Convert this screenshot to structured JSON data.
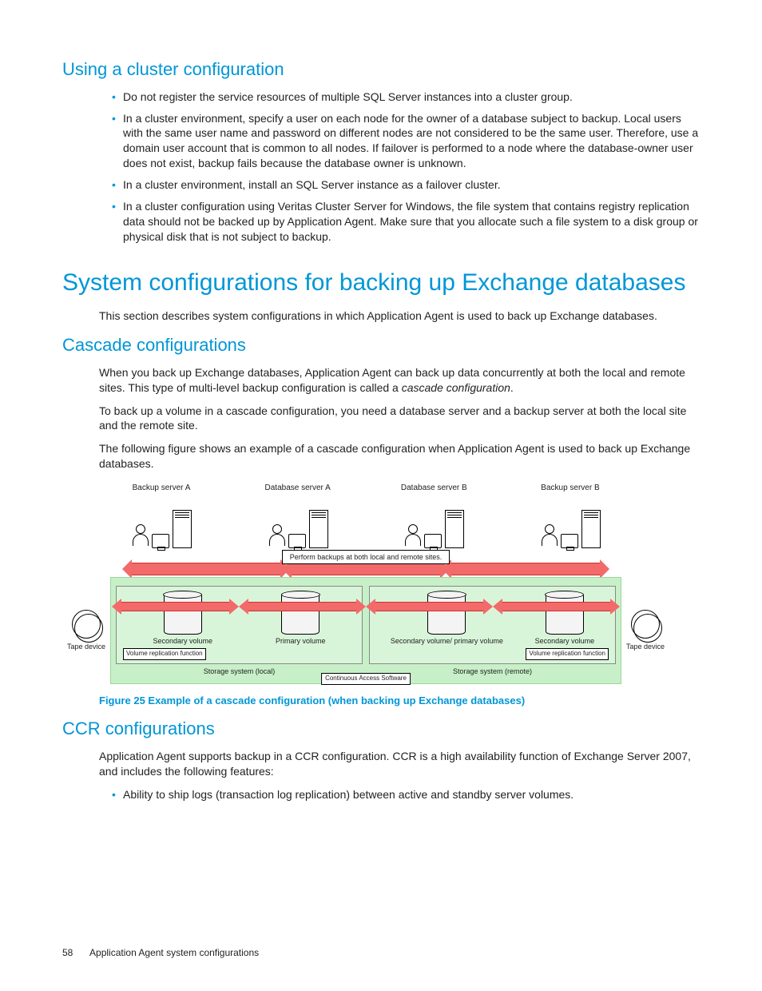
{
  "headings": {
    "using_cluster": "Using a cluster configuration",
    "sys_config": "System configurations for backing up Exchange databases",
    "cascade": "Cascade configurations",
    "ccr": "CCR configurations"
  },
  "bullets_cluster": [
    "Do not register the service resources of multiple SQL Server instances into a cluster group.",
    "In a cluster environment, specify a user on each node for the owner of a database subject to backup. Local users with the same user name and password on different nodes are not considered to be the same user. Therefore, use a domain user account that is common to all nodes. If failover is performed to a node where the database-owner user does not exist, backup fails because the database owner is unknown.",
    "In a cluster environment, install an SQL Server instance as a failover cluster.",
    "In a cluster configuration using Veritas Cluster Server for Windows, the file system that contains registry replication data should not be backed up by Application Agent. Make sure that you allocate such a file system to a disk group or physical disk that is not subject to backup."
  ],
  "paragraphs": {
    "sys_intro": "This section describes system configurations in which Application Agent is used to back up Exchange databases.",
    "cascade_p1_a": "When you back up Exchange databases, Application Agent can back up data concurrently at both the local and remote sites. This type of multi-level backup configuration is called a ",
    "cascade_p1_b": "cascade configuration",
    "cascade_p1_c": ".",
    "cascade_p2": "To back up a volume in a cascade configuration, you need a database server and a backup server at both the local site and the remote site.",
    "cascade_p3": "The following figure shows an example of a cascade configuration when Application Agent is used to back up Exchange databases.",
    "ccr_p1": "Application Agent supports backup in a CCR configuration. CCR is a high availability function of Exchange Server 2007, and includes the following features:"
  },
  "bullets_ccr": [
    "Ability to ship logs (transaction log replication) between active and standby server volumes."
  ],
  "figure": {
    "caption": "Figure 25 Example of a cascade configuration (when backing up Exchange databases)",
    "top_labels": [
      "Backup server A",
      "Database server A",
      "Database server B",
      "Backup server B"
    ],
    "perf_box": "Perform backups at both local and remote sites.",
    "tape_label": "Tape device",
    "vol_labels": {
      "sec": "Secondary volume",
      "pri": "Primary volume",
      "secpri": "Secondary volume/ primary volume"
    },
    "volrep": "Volume replication function",
    "cas": "Continuous Access Software",
    "sys_local": "Storage system (local)",
    "sys_remote": "Storage system (remote)"
  },
  "footer": {
    "page": "58",
    "title": "Application Agent system configurations"
  }
}
